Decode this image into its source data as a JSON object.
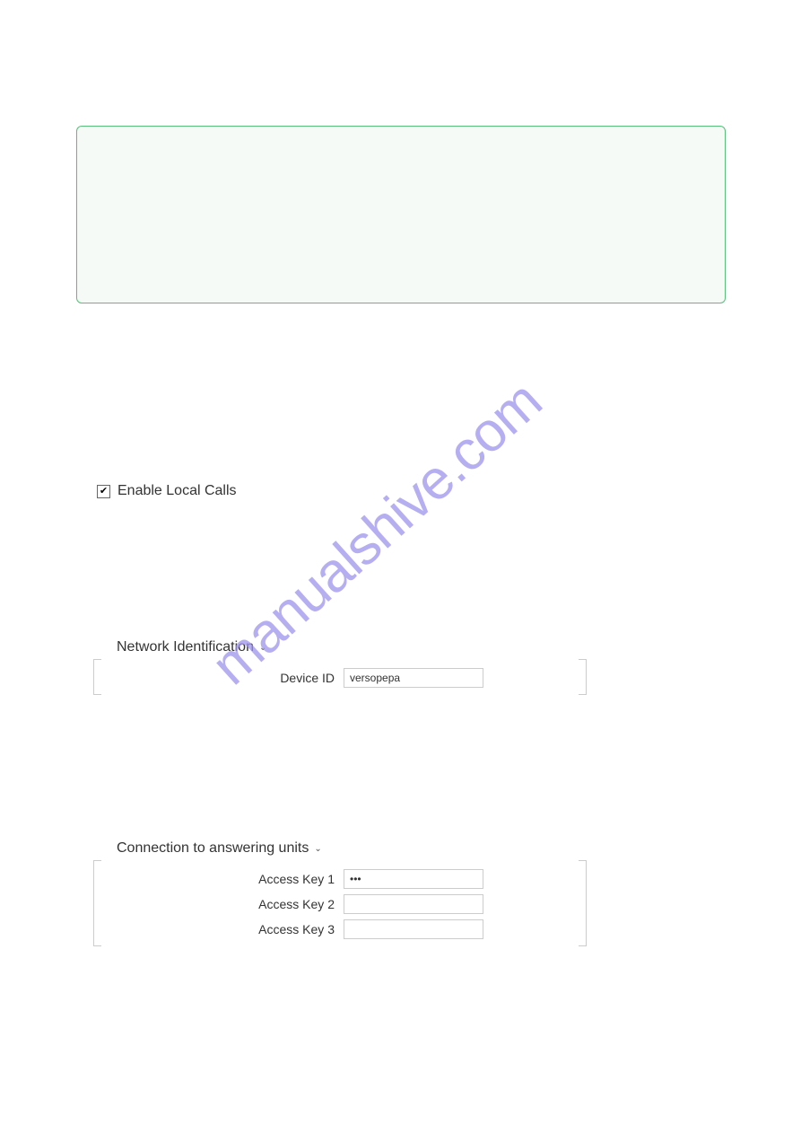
{
  "watermark": "manualshive.com",
  "enable_local_calls": {
    "label": "Enable Local Calls",
    "checked": true
  },
  "network_identification": {
    "title": "Network Identification",
    "device_id_label": "Device ID",
    "device_id_value": "versopepa"
  },
  "connection_answering_units": {
    "title": "Connection to answering units",
    "keys": [
      {
        "label": "Access Key 1",
        "value": "•••"
      },
      {
        "label": "Access Key 2",
        "value": ""
      },
      {
        "label": "Access Key 3",
        "value": ""
      }
    ]
  }
}
